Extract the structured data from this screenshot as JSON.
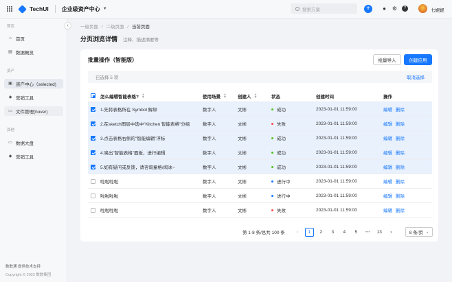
{
  "topbar": {
    "logo": "TechUI",
    "app_title": "企业级资产中心",
    "search_placeholder": "搜索方案",
    "user_name": "七妮妮"
  },
  "sidebar": {
    "sections": [
      {
        "title": "首页",
        "items": [
          {
            "label": "首页",
            "icon": "home-icon"
          },
          {
            "label": "数据概览",
            "icon": "chart-icon"
          }
        ]
      },
      {
        "title": "资产",
        "items": [
          {
            "label": "资产中心（selected)",
            "icon": "box-icon"
          },
          {
            "label": "营销工具",
            "icon": "drop-icon"
          },
          {
            "label": "文件管理(hover)",
            "icon": "folder-icon"
          }
        ]
      },
      {
        "title": "其他",
        "items": [
          {
            "label": "数据大盘",
            "icon": "monitor-icon"
          },
          {
            "label": "营销工具",
            "icon": "drop-icon"
          }
        ]
      }
    ],
    "footer_brand": "数数通",
    "footer_note": "提供技术支持",
    "copyright": "Copyright © 2022 数数集团"
  },
  "breadcrumb": [
    "一级页面",
    "/",
    "二级页面",
    "/",
    "当前页面"
  ],
  "page": {
    "title": "分页浏览详情",
    "subtitle": "注释、描述摘要等"
  },
  "card": {
    "title": "批量操作（智能版）",
    "import_label": "批量导入",
    "create_label": "创建应用",
    "selected_text": "已选择  5  项",
    "cancel_label": "取消选择"
  },
  "table": {
    "headers": [
      "怎么编辑智能表格?",
      "使用场景",
      "创建人",
      "状态",
      "创建时间",
      "操作"
    ],
    "rows": [
      {
        "checked": true,
        "name": "1.先将表格所在 Symbol 解绑",
        "scene": "数字人",
        "creator": "文彬",
        "status": "成功",
        "status_color": "#52c41a",
        "time": "2023-01-01 11:59:00",
        "edit": "编辑",
        "del": "删除"
      },
      {
        "checked": true,
        "name": "2.在sketch图层中选中\"Kitchen 智能表格\"分组",
        "scene": "数字人",
        "creator": "文彬",
        "status": "失败",
        "status_color": "#ff4d4f",
        "time": "2023-01-01 11:59:00",
        "edit": "编辑",
        "del": "删除"
      },
      {
        "checked": true,
        "name": "3.点击表格右侧的\"智能编辑\"浮标",
        "scene": "数字人",
        "creator": "文彬",
        "status": "成功",
        "status_color": "#52c41a",
        "time": "2023-01-01 11:59:00",
        "edit": "编辑",
        "del": "删除"
      },
      {
        "checked": true,
        "name": "4.唤出\"智能表格\"面板，进行编辑",
        "scene": "数字人",
        "creator": "文彬",
        "status": "成功",
        "status_color": "#52c41a",
        "time": "2023-01-01 11:59:00",
        "edit": "编辑",
        "del": "删除"
      },
      {
        "checked": true,
        "name": "5.如有疑问或反馈，请咨询童格/闻冰~",
        "scene": "数字人",
        "creator": "文彬",
        "status": "成功",
        "status_color": "#52c41a",
        "time": "2023-01-01 11:59:00",
        "edit": "编辑",
        "del": "删除"
      },
      {
        "checked": false,
        "name": "啦啦啦啦",
        "scene": "数字人",
        "creator": "文彬",
        "status": "进行中",
        "status_color": "#1677ff",
        "time": "2023-01-01 11:59:00",
        "edit": "编辑",
        "del": "删除"
      },
      {
        "checked": false,
        "name": "啦啦啦啦",
        "scene": "数字人",
        "creator": "文彬",
        "status": "进行中",
        "status_color": "#1677ff",
        "time": "2023-01-01 11:59:00",
        "edit": "编辑",
        "del": "删除"
      },
      {
        "checked": false,
        "name": "啦啦啦啦",
        "scene": "数字人",
        "creator": "文彬",
        "status": "失败",
        "status_color": "#ff4d4f",
        "time": "2023-01-01 11:59:00",
        "edit": "编辑",
        "del": "删除"
      }
    ]
  },
  "pagination": {
    "summary": "第 1-8 条/总共 100 条",
    "pages": [
      "1",
      "2",
      "3",
      "4",
      "5",
      "•••",
      "13"
    ],
    "current": "1",
    "page_size": "8 条/页"
  },
  "colors": {
    "accent": "#1677ff",
    "selected_row": "#e9f1fd"
  }
}
